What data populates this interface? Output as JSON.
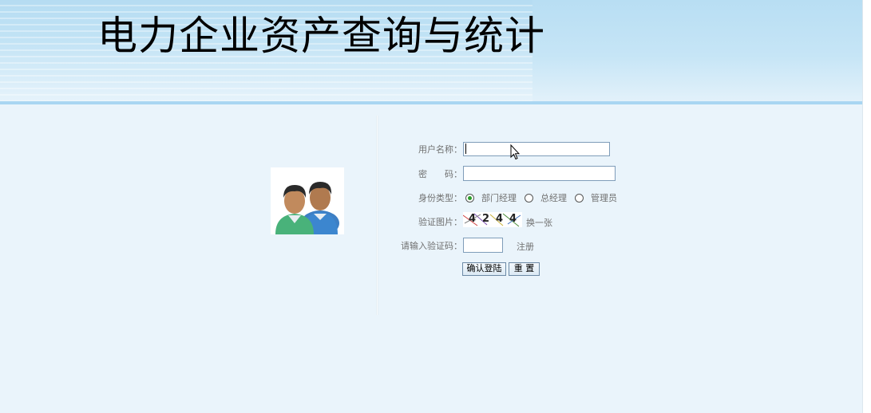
{
  "header": {
    "title": "电力企业资产查询与统计"
  },
  "login_form": {
    "username_label": "用户名称：",
    "username_value": "",
    "password_label": "密　　码：",
    "password_value": "",
    "identity_label": "身份类型：",
    "identity_options": [
      {
        "label": "部门经理",
        "checked": true
      },
      {
        "label": "总经理",
        "checked": false
      },
      {
        "label": "管理员",
        "checked": false
      }
    ],
    "captcha_label": "验证图片：",
    "captcha_chars": [
      "4",
      "2",
      "4",
      "4"
    ],
    "refresh_captcha_label": "换一张",
    "captcha_input_label": "请输入验证码：",
    "captcha_input_value": "",
    "register_label": "注册",
    "login_button_label": "确认登陆",
    "reset_button_label": "重 置"
  },
  "colors": {
    "page_background": "#eaf4fb",
    "header_rule": "#a9d6f2",
    "label_text": "#707070",
    "radio_selected": "#2a9d2a"
  },
  "icons": {
    "avatar": "users-icon",
    "cursor": "mouse-pointer-icon"
  }
}
